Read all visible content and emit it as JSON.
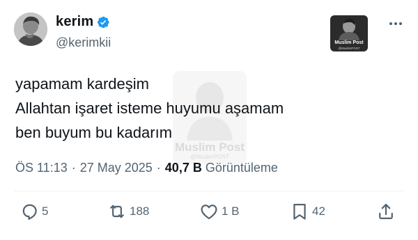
{
  "author": {
    "display_name": "kerim",
    "handle": "@kerimkii",
    "verified": true
  },
  "watermark": {
    "title": "Muslim Post",
    "subtitle": "@MuslimPOST"
  },
  "tweet": {
    "lines": [
      "yapamam kardeşim",
      "Allahtan işaret isteme huyumu aşamam",
      "ben buyum bu kadarım"
    ]
  },
  "meta": {
    "time": "ÖS 11:13",
    "separator": "·",
    "date": "27 May 2025",
    "views_count": "40,7 B",
    "views_label": "Görüntüleme"
  },
  "actions": {
    "replies": "5",
    "reposts": "188",
    "likes": "1 B",
    "bookmarks": "42"
  },
  "colors": {
    "text_primary": "#0f1419",
    "text_secondary": "#536471",
    "verified_blue": "#1d9bf0",
    "divider": "#eff3f4"
  },
  "icons": [
    "verified-badge-icon",
    "more-options-icon",
    "reply-icon",
    "repost-icon",
    "like-icon",
    "bookmark-icon",
    "share-icon"
  ]
}
